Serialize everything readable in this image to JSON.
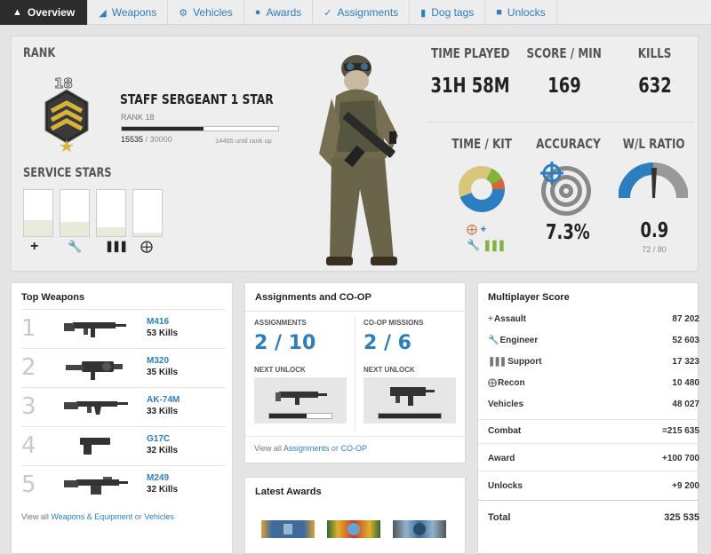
{
  "tabs": [
    {
      "label": "Overview",
      "icon": "chevron-up-icon"
    },
    {
      "label": "Weapons",
      "icon": "gun-icon"
    },
    {
      "label": "Vehicles",
      "icon": "gear-icon"
    },
    {
      "label": "Awards",
      "icon": "medal-icon"
    },
    {
      "label": "Assignments",
      "icon": "check-icon"
    },
    {
      "label": "Dog tags",
      "icon": "tag-icon"
    },
    {
      "label": "Unlocks",
      "icon": "lock-icon"
    }
  ],
  "rank": {
    "heading": "RANK",
    "badge_number": "18",
    "title": "STAFF SERGEANT 1 STAR",
    "subtitle": "RANK 18",
    "xp": "15535",
    "xp_total": "/ 30000",
    "until": "14465 until rank up",
    "progress": 0.52
  },
  "service_stars": {
    "heading": "SERVICE STARS",
    "fills": [
      0.35,
      0.3,
      0.2,
      0.08
    ],
    "icons": [
      "plus-icon",
      "wrench-icon",
      "ammo-icon",
      "crosshair-icon"
    ]
  },
  "stats": {
    "time_played": {
      "label": "TIME PLAYED",
      "value": "31H 58M"
    },
    "score_min": {
      "label": "SCORE / MIN",
      "value": "169"
    },
    "kills": {
      "label": "KILLS",
      "value": "632"
    },
    "time_kit": {
      "label": "TIME / KIT"
    },
    "accuracy": {
      "label": "ACCURACY",
      "value": "7.3%"
    },
    "wl": {
      "label": "W/L RATIO",
      "value": "0.9",
      "sub": "72 / 80"
    }
  },
  "top_weapons": {
    "title": "Top Weapons",
    "items": [
      {
        "rank": "1",
        "name": "M416",
        "kills": "53 Kills"
      },
      {
        "rank": "2",
        "name": "M320",
        "kills": "35 Kills"
      },
      {
        "rank": "3",
        "name": "AK-74M",
        "kills": "33 Kills"
      },
      {
        "rank": "4",
        "name": "G17C",
        "kills": "32 Kills"
      },
      {
        "rank": "5",
        "name": "M249",
        "kills": "32 Kills"
      }
    ],
    "footer_pre": "View all",
    "footer_link1": "Weapons & Equipment",
    "footer_mid": "or",
    "footer_link2": "Vehicles"
  },
  "assignments": {
    "title": "Assignments and CO-OP",
    "a_label": "ASSIGNMENTS",
    "a_value": "2 / 10",
    "a_next": "NEXT UNLOCK",
    "a_progress": 0.6,
    "c_label": "CO-OP MISSIONS",
    "c_value": "2 / 6",
    "c_next": "NEXT UNLOCK",
    "c_progress": 1.0,
    "footer_pre": "View all",
    "footer_link1": "Assignments",
    "footer_mid": "or",
    "footer_link2": "CO-OP"
  },
  "awards": {
    "title": "Latest Awards"
  },
  "mp_score": {
    "title": "Multiplayer Score",
    "rows": [
      {
        "icon": "plus-icon",
        "label": "Assault",
        "value": "87 202"
      },
      {
        "icon": "wrench-icon",
        "label": "Engineer",
        "value": "52 603"
      },
      {
        "icon": "ammo-icon",
        "label": "Support",
        "value": "17 323"
      },
      {
        "icon": "crosshair-icon",
        "label": "Recon",
        "value": "10 480"
      },
      {
        "icon": "",
        "label": "Vehicles",
        "value": "48 027"
      }
    ],
    "combat_label": "Combat",
    "combat_value": "=215 635",
    "award_label": "Award",
    "award_value": "+100 700",
    "unlocks_label": "Unlocks",
    "unlocks_value": "+9 200",
    "total_label": "Total",
    "total_value": "325 535"
  }
}
